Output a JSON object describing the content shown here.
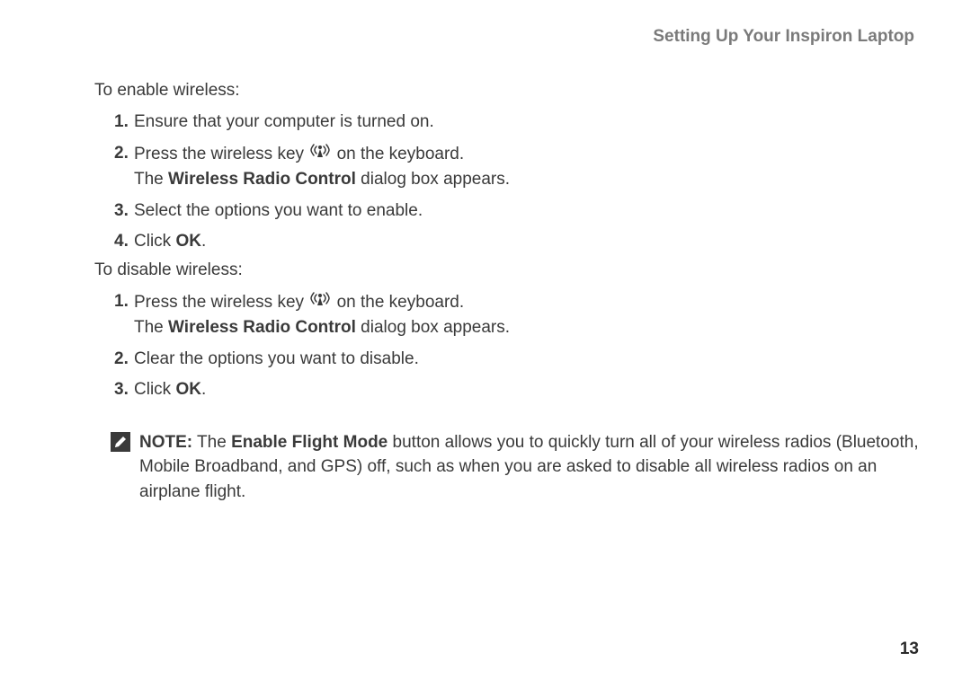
{
  "header": {
    "title": "Setting Up Your Inspiron Laptop"
  },
  "section_enable": {
    "intro": "To enable wireless:",
    "steps": [
      {
        "num": "1.",
        "text_before": "Ensure that your computer is turned on."
      },
      {
        "num": "2.",
        "text_before": "Press the wireless key ",
        "text_after": " on the keyboard.",
        "line2_prefix": "The ",
        "line2_bold": "Wireless Radio Control",
        "line2_suffix": " dialog box appears."
      },
      {
        "num": "3.",
        "text_before": "Select the options you want to enable."
      },
      {
        "num": "4.",
        "text_before": "Click ",
        "bold_end": "OK",
        "suffix": "."
      }
    ]
  },
  "section_disable": {
    "intro": "To disable wireless:",
    "steps": [
      {
        "num": "1.",
        "text_before": "Press the wireless key ",
        "text_after": " on the keyboard.",
        "line2_prefix": "The ",
        "line2_bold": "Wireless Radio Control",
        "line2_suffix": " dialog box appears."
      },
      {
        "num": "2.",
        "text_before": "Clear the options you want to disable."
      },
      {
        "num": "3.",
        "text_before": "Click ",
        "bold_end": "OK",
        "suffix": "."
      }
    ]
  },
  "note": {
    "label": "NOTE:",
    "prefix": " The ",
    "bold1": "Enable Flight Mode",
    "rest": " button allows you to quickly turn all of your wireless radios (Bluetooth, Mobile Broadband, and GPS) off, such as when you are asked to disable all wireless radios on an airplane flight."
  },
  "page_number": "13"
}
